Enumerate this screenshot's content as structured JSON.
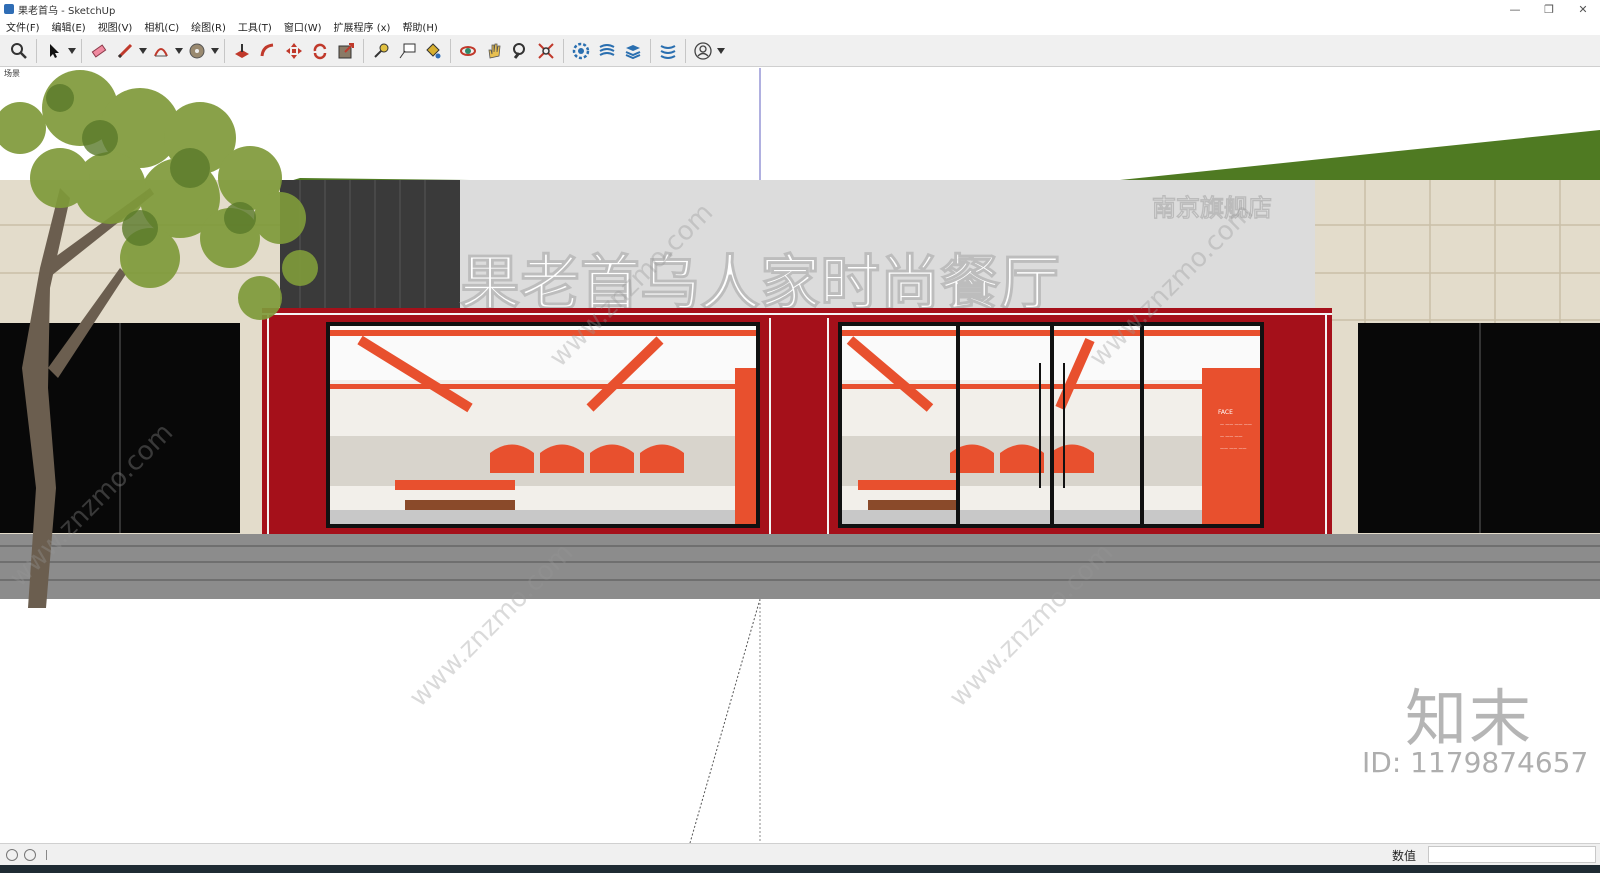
{
  "window": {
    "title": "果老首乌 - SketchUp"
  },
  "window_controls": {
    "minimize": "—",
    "restore": "❐",
    "close": "✕"
  },
  "menu": [
    "文件(F)",
    "编辑(E)",
    "视图(V)",
    "相机(C)",
    "绘图(R)",
    "工具(T)",
    "窗口(W)",
    "扩展程序 (x)",
    "帮助(H)"
  ],
  "toolbar": {
    "tools": [
      "zoom-extents",
      "select",
      "eraser",
      "pencil",
      "arc",
      "paint",
      "push-pull",
      "follow-me",
      "move",
      "rotate",
      "scale",
      "tape-measure",
      "text",
      "paint-bucket",
      "orbit",
      "pan",
      "zoom",
      "zoom-window",
      "warehouse",
      "extension-warehouse",
      "layout",
      "sandbox",
      "account"
    ]
  },
  "viewport": {
    "scene_tab": "场景",
    "signage": {
      "main": "果老首乌人家时尚餐厅",
      "sub": "南京旗舰店"
    },
    "wall_board": {
      "heading": "FACE",
      "lines": [
        "— —— —— ——",
        "— —— ——",
        "—— —— ——"
      ]
    },
    "watermark": {
      "brand": "知末",
      "id": "ID: 1179874657",
      "url": "www.znzmo.com"
    },
    "colors": {
      "frame_red": "#a5101a",
      "accent_orange": "#e8502e",
      "sky": "#ffffff",
      "lawn": "#4f7a22",
      "pavement": "#8c8c8c"
    }
  },
  "statusbar": {
    "measurements_label": "数值",
    "measurements_value": ""
  }
}
